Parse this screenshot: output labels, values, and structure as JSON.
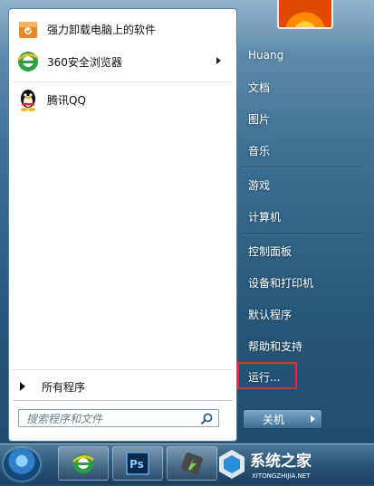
{
  "programs": [
    {
      "label": "强力卸载电脑上的软件",
      "icon": "uninstaller-box-icon",
      "has_submenu": false
    },
    {
      "label": "360安全浏览器",
      "icon": "360-browser-icon",
      "has_submenu": true
    },
    {
      "label": "腾讯QQ",
      "icon": "qq-penguin-icon",
      "has_submenu": false
    }
  ],
  "all_programs_label": "所有程序",
  "search": {
    "placeholder": "搜索程序和文件"
  },
  "right_items": [
    {
      "label": "Huang"
    },
    {
      "label": "文档"
    },
    {
      "label": "图片"
    },
    {
      "label": "音乐"
    },
    {
      "label": "游戏"
    },
    {
      "label": "计算机"
    },
    {
      "label": "控制面板"
    },
    {
      "label": "设备和打印机"
    },
    {
      "label": "默认程序"
    },
    {
      "label": "帮助和支持"
    },
    {
      "label": "运行..."
    }
  ],
  "shutdown_label": "关机",
  "highlight_color": "#d9302c",
  "watermark": {
    "text": "系统之家",
    "subtext": "XITONGZHIJIA.NET"
  }
}
